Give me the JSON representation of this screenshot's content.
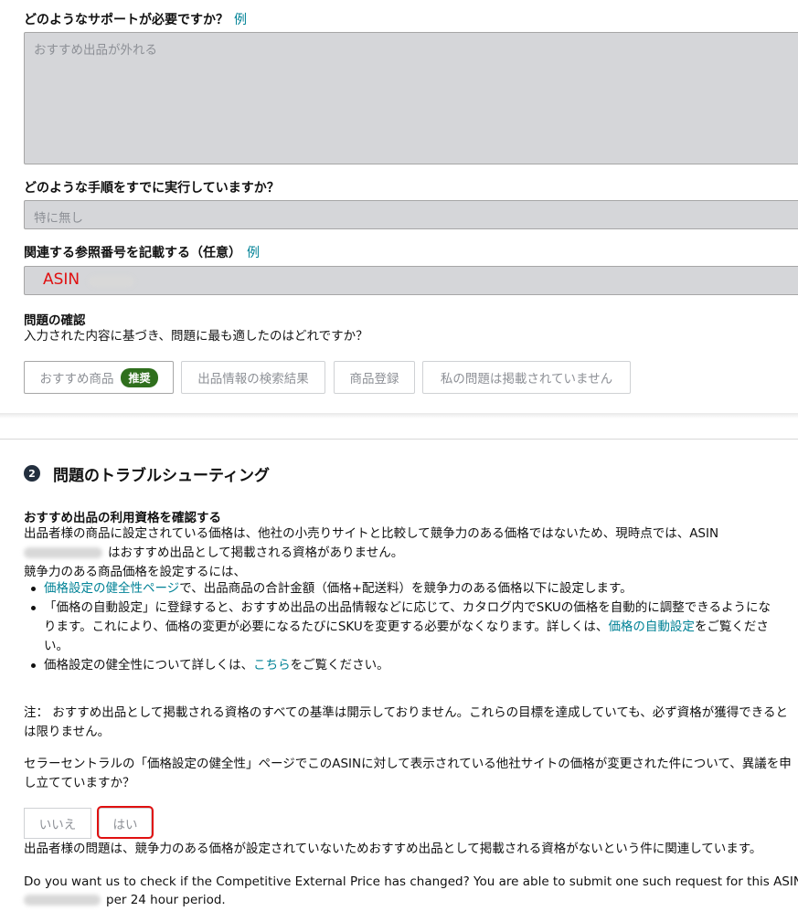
{
  "q1": {
    "label": "どのようなサポートが必要ですか？",
    "example_link": "例",
    "value": "おすすめ出品が外れる"
  },
  "q2": {
    "label": "どのような手順をすでに実行していますか？",
    "value": "特に無し"
  },
  "q3": {
    "label": "関連する参照番号を記載する（任意）",
    "example_link": "例",
    "value": "ASIN"
  },
  "confirm": {
    "heading": "問題の確認",
    "text": "入力された内容に基づき、問題に最も適したのはどれですか？",
    "options": [
      {
        "label": "おすすめ商品",
        "badge": "推奨"
      },
      {
        "label": "出品情報の検索結果"
      },
      {
        "label": "商品登録"
      },
      {
        "label": "私の問題は掲載されていません"
      }
    ]
  },
  "section2": {
    "step_number": "2",
    "title": "問題のトラブルシューティング",
    "subheading": "おすすめ出品の利用資格を確認する",
    "para1_line1": "出品者様の商品に設定されている価格は、他社の小売りサイトと比較して競争力のある価格ではないため、現時点では、ASIN",
    "para1_line2": "はおすすめ出品として掲載される資格がありません。",
    "para2": "競争力のある商品価格を設定するには、",
    "bullet1_link": "価格設定の健全性ページ",
    "bullet1_text": "で、出品商品の合計金額（価格+配送料）を競争力のある価格以下に設定します。",
    "bullet2_line1": "「価格の自動設定」に登録すると、おすすめ出品の出品情報などに応じて、カタログ内でSKUの価格を自動的に調整できるようにな",
    "bullet2_line2a": "ります。これにより、価格の変更が必要になるたびにSKUを変更する必要がなくなります。詳しくは、",
    "bullet2_link": "価格の自動設定",
    "bullet2_line2b": "をご覧くださ",
    "bullet2_line3": "い。",
    "bullet3_text_a": "価格設定の健全性について詳しくは、",
    "bullet3_link": "こちら",
    "bullet3_text_b": "をご覧ください。",
    "note_line1": "注： おすすめ出品として掲載される資格のすべての基準は開示しておりません。これらの目標を達成していても、必ず資格が獲得できると",
    "note_line2": "は限りません。",
    "question_line1": "セラーセントラルの「価格設定の健全性」ページでこのASINに対して表示されている他社サイトの価格が変更された件について、異議を申",
    "question_line2": "し立てていますか？",
    "no_label": "いいえ",
    "yes_label": "はい",
    "issue_text": "出品者様の問題は、競争力のある価格が設定されていないためおすすめ出品として掲載される資格がないという件に関連しています。",
    "english_line1": "Do you want us to check if the Competitive External Price has changed? You are able to submit one such request for this ASIN",
    "english_line2": "per 24 hour period."
  },
  "colors": {
    "link": "#008296",
    "badge": "#2f6f1d",
    "highlight": "#e01010",
    "field_bg": "#d5d6d9"
  }
}
